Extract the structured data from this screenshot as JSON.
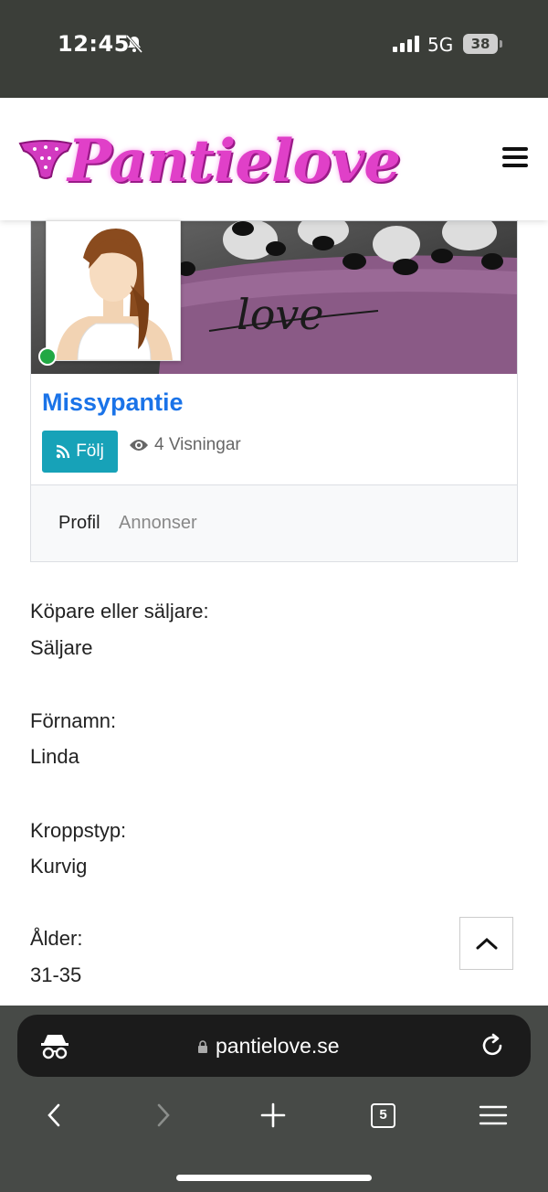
{
  "status_bar": {
    "time": "12:45",
    "network": "5G",
    "battery": "38"
  },
  "header": {
    "logo_text": "Pantielove",
    "menu_icon": "hamburger-icon"
  },
  "profile": {
    "username": "Missypantie",
    "follow_label": "Följ",
    "views_label": "4 Visningar",
    "online_color": "#22a844",
    "tabs": [
      {
        "label": "Profil"
      },
      {
        "label": "Annonser"
      }
    ],
    "banner_text": "love"
  },
  "fields": [
    {
      "label": "Köpare eller säljare:",
      "value": "Säljare"
    },
    {
      "label": "Förnamn:",
      "value": "Linda"
    },
    {
      "label": "Kroppstyp:",
      "value": "Kurvig"
    },
    {
      "label": "Ålder:",
      "value": "31-35"
    }
  ],
  "browser": {
    "url": "pantielove.se",
    "tab_count": "5"
  },
  "colors": {
    "brand": "#e040c8",
    "link": "#1a73e8",
    "follow_button": "#17a2b8"
  }
}
